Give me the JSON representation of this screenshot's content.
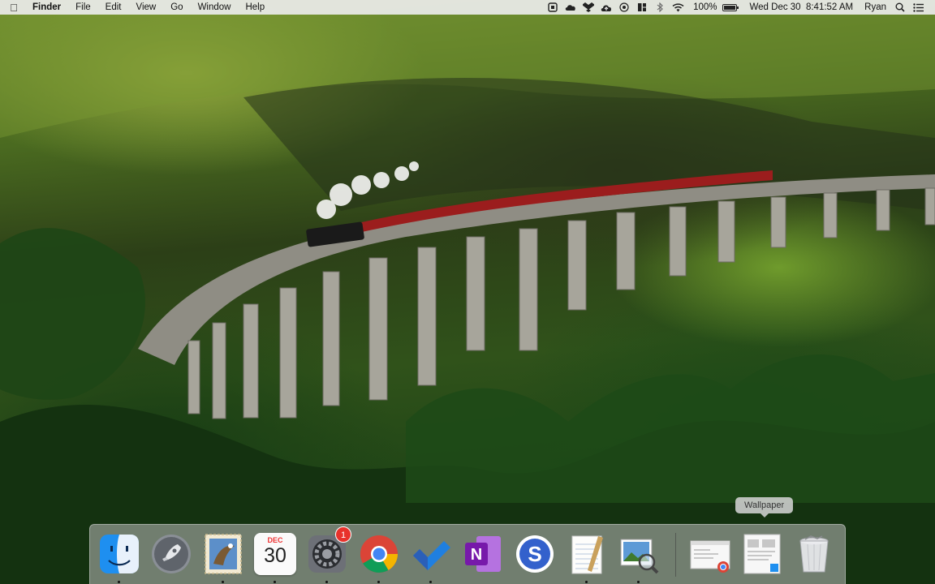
{
  "menubar": {
    "app_name": "Finder",
    "menus": [
      "File",
      "Edit",
      "View",
      "Go",
      "Window",
      "Help"
    ],
    "battery": "100%",
    "battery_level": 1.0,
    "datetime": "Wed Dec 30  8:41:52 AM",
    "user": "Ryan",
    "status_icons": [
      "notes-icon",
      "cloud-icon",
      "dropbox-icon",
      "cloud-upload-icon",
      "target-icon",
      "split-icon",
      "bluetooth-icon",
      "wifi-icon",
      "battery-icon",
      "search-icon",
      "list-icon"
    ]
  },
  "tooltip": {
    "text": "Wallpaper"
  },
  "dock": {
    "items": [
      {
        "name": "finder",
        "icon": "finder-icon",
        "running": true
      },
      {
        "name": "launchpad",
        "icon": "rocket-icon",
        "running": false
      },
      {
        "name": "mail",
        "icon": "eagle-stamp-icon",
        "running": true
      },
      {
        "name": "calendar",
        "icon": "calendar-icon",
        "month": "DEC",
        "day": "30",
        "running": true
      },
      {
        "name": "system-preferences",
        "icon": "gear-icon",
        "badge": "1",
        "running": true
      },
      {
        "name": "chrome",
        "icon": "chrome-icon",
        "running": true
      },
      {
        "name": "todo",
        "icon": "checkmark-icon",
        "running": true
      },
      {
        "name": "onenote",
        "icon": "onenote-icon",
        "letter": "N",
        "running": false
      },
      {
        "name": "simplenote",
        "icon": "simplenote-icon",
        "letter": "S",
        "running": false
      },
      {
        "name": "textedit",
        "icon": "notepad-icon",
        "running": true
      },
      {
        "name": "preview",
        "icon": "preview-icon",
        "running": true
      },
      {
        "name": "minimized-chrome-window",
        "icon": "window-thumbnail-icon",
        "running": false
      },
      {
        "name": "minimized-wallpaper-window",
        "icon": "window-thumbnail-icon",
        "running": false
      },
      {
        "name": "trash",
        "icon": "trash-icon",
        "running": false
      }
    ]
  }
}
